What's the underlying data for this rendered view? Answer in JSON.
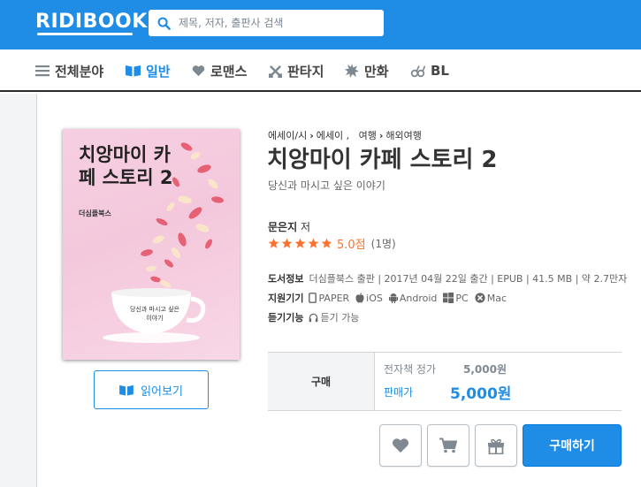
{
  "header": {
    "logo": "RIDIBOOKS",
    "search_placeholder": "제목, 저자, 출판사 검색"
  },
  "nav": [
    {
      "label": "전체분야",
      "icon": "menu-icon"
    },
    {
      "label": "일반",
      "icon": "book-icon",
      "active": true
    },
    {
      "label": "로맨스",
      "icon": "heart-icon"
    },
    {
      "label": "판타지",
      "icon": "swords-icon"
    },
    {
      "label": "만화",
      "icon": "burst-icon"
    },
    {
      "label": "BL",
      "icon": "gender-icon"
    }
  ],
  "book": {
    "cover_title": "치앙마이 카페 스토리 2",
    "cover_publisher": "더심플북스",
    "cover_cup_text": "당신과 마시고 싶은 이야기",
    "breadcrumb": [
      "에세이/시",
      "에세이 ,",
      "여행",
      "해외여행"
    ],
    "title": "치앙마이 카페 스토리 2",
    "subtitle": "당신과 마시고 싶은 이야기",
    "author_name": "문은지",
    "author_role": "저",
    "rating": "5.0점",
    "rating_value": 5.0,
    "rating_count": "(1명)",
    "info_label": "도서정보",
    "info_text": "더심플북스 출판 | 2017년 04월 22일 출간 | EPUB | 41.5 MB | 약 2.7만자",
    "devices_label": "지원기기",
    "devices": [
      {
        "label": "PAPER",
        "icon": "phone-icon"
      },
      {
        "label": "iOS",
        "icon": "apple-icon"
      },
      {
        "label": "Android",
        "icon": "android-icon"
      },
      {
        "label": "PC",
        "icon": "windows-icon"
      },
      {
        "label": "Mac",
        "icon": "mac-icon"
      }
    ],
    "listen_label": "듣기기능",
    "listen_text": "듣기 가능"
  },
  "purchase": {
    "label": "구매",
    "ebook_price_label": "전자책 정가",
    "ebook_price": "5,000원",
    "sale_price_label": "판매가",
    "sale_price": "5,000원"
  },
  "actions": {
    "read_preview": "읽어보기",
    "buy": "구매하기"
  },
  "colors": {
    "brand": "#1f8ce6",
    "rating": "#fa722e"
  }
}
